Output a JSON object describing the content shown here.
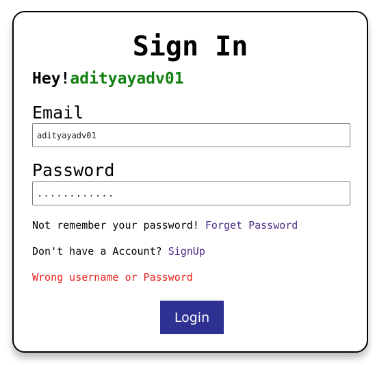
{
  "form": {
    "title": "Sign In",
    "greeting_prefix": "Hey!",
    "greeting_user": "adityayadv01",
    "email_label": "Email",
    "email_value": "adityayadv01",
    "password_label": "Password",
    "password_value": "............",
    "forget_text": "Not remember your password! ",
    "forget_link": "Forget Password",
    "signup_text": "Don't have a Account? ",
    "signup_link": "SignUp",
    "error_message": "Wrong username or Password",
    "login_label": "Login"
  },
  "colors": {
    "username": "#118011",
    "link": "#4b2a87",
    "error": "#e8201a",
    "button": "#2e3192"
  }
}
